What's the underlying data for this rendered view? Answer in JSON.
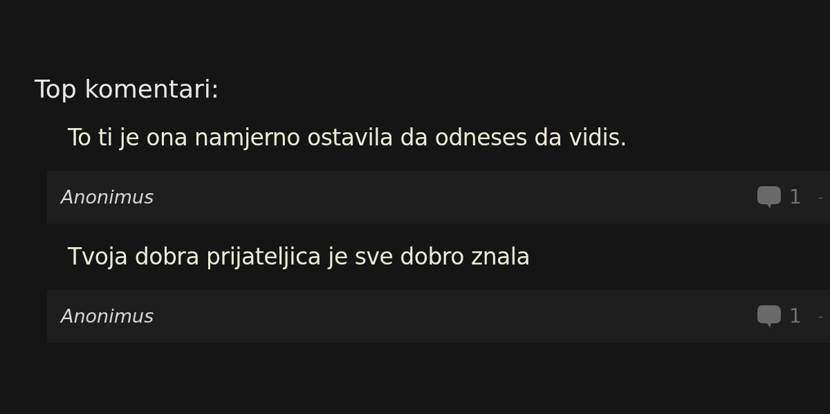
{
  "heading": "Top komentari:",
  "comments": [
    {
      "text": "To ti je ona namjerno ostavila da odneses da vidis.",
      "author": "Anonimus",
      "replies": "1",
      "separator": "-"
    },
    {
      "text": "Tvoja dobra prijateljica je sve dobro znala",
      "author": "Anonimus",
      "replies": "1",
      "separator": "-"
    }
  ]
}
